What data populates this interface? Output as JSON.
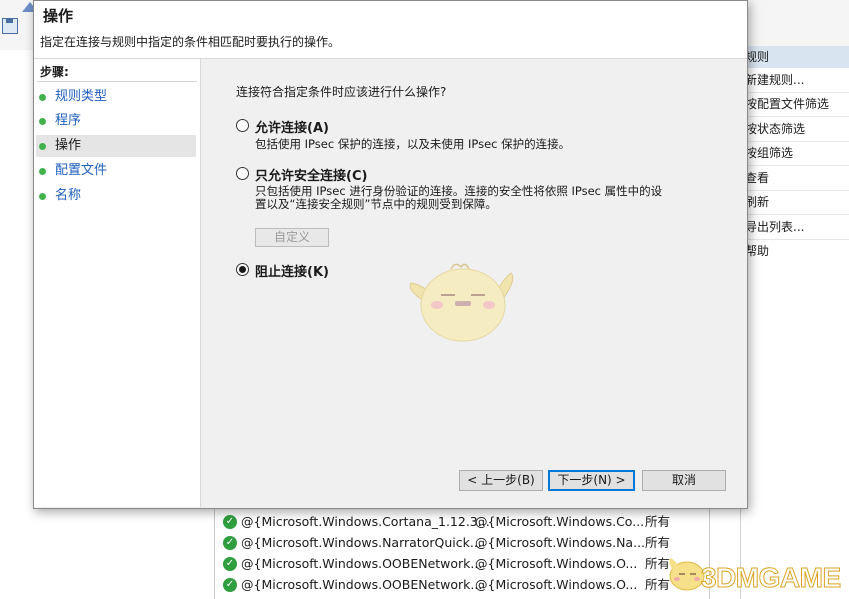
{
  "dialog": {
    "title": "操作",
    "subtitle": "指定在连接与规则中指定的条件相匹配时要执行的操作。",
    "steps_title": "步骤:",
    "steps": [
      {
        "label": "规则类型",
        "active": false
      },
      {
        "label": "程序",
        "active": false
      },
      {
        "label": "操作",
        "active": true
      },
      {
        "label": "配置文件",
        "active": false
      },
      {
        "label": "名称",
        "active": false
      }
    ],
    "question": "连接符合指定条件时应该进行什么操作?",
    "options": [
      {
        "label": "允许连接(A)",
        "checked": false,
        "description": "包括使用 IPsec 保护的连接，以及未使用 IPsec 保护的连接。"
      },
      {
        "label": "只允许安全连接(C)",
        "checked": false,
        "description_line1": "只包括使用 IPsec 进行身份验证的连接。连接的安全性将依照 IPsec 属性中的设",
        "description_line2": "置以及“连接安全规则”节点中的规则受到保障。"
      },
      {
        "label": "阻止连接(K)",
        "checked": true
      }
    ],
    "customize_label": "自定义",
    "back_label": "< 上一步(B)",
    "next_label": "下一步(N) >",
    "cancel_label": "取消"
  },
  "actions_pane": {
    "header": "规则",
    "items": [
      "新建规则...",
      "按配置文件筛选",
      "按状态筛选",
      "按组筛选",
      "查看",
      "刷新",
      "导出列表...",
      "帮助"
    ]
  },
  "rules_list": [
    {
      "name": "@{Microsoft.Windows.Cortana_1.12.3...",
      "group": "@{Microsoft.Windows.Co...",
      "profile": "所有"
    },
    {
      "name": "@{Microsoft.Windows.NarratorQuick...",
      "group": "@{Microsoft.Windows.Na...",
      "profile": "所有"
    },
    {
      "name": "@{Microsoft.Windows.OOBENetwork...",
      "group": "@{Microsoft.Windows.O...",
      "profile": "所有"
    },
    {
      "name": "@{Microsoft.Windows.OOBENetwork...",
      "group": "@{Microsoft.Windows.O...",
      "profile": "所有"
    }
  ],
  "watermark": {
    "text": "3DMGAME"
  },
  "colors": {
    "accent": "#0078d7",
    "link": "#1f5fbf",
    "step_dot": "#41b24b",
    "enabled_check": "#2e9e3e",
    "watermark": "#d9a321"
  }
}
